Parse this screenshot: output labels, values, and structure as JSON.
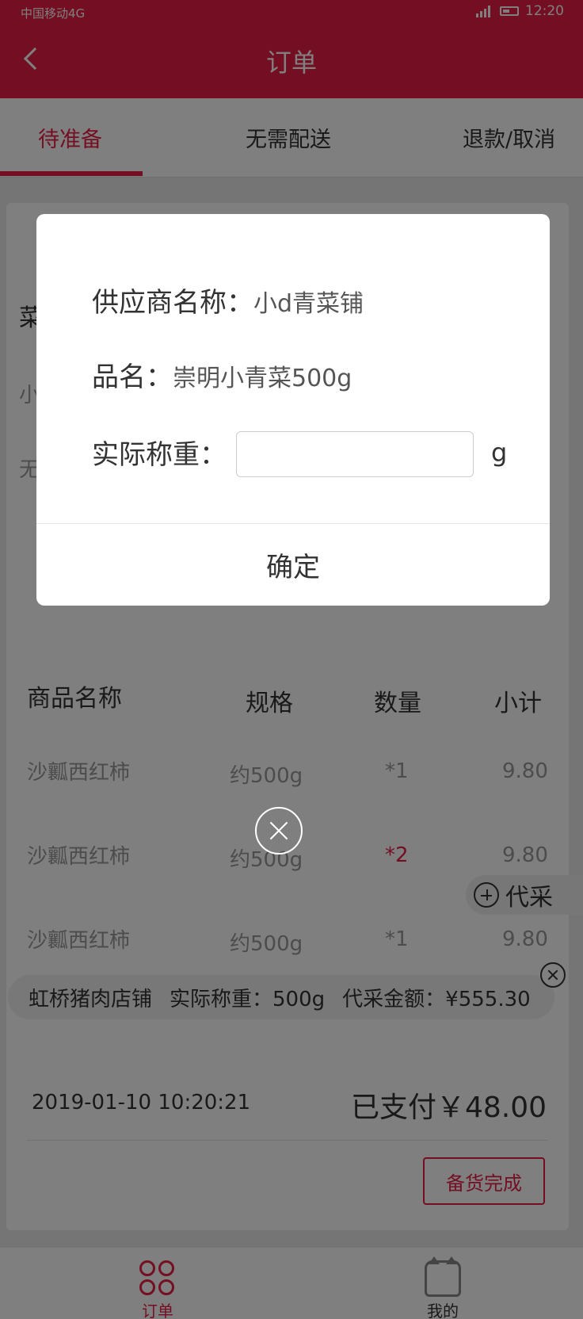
{
  "status_bar": {
    "carrier": "中国移动4G",
    "time": "12:20"
  },
  "header": {
    "title": "订单"
  },
  "tabs": [
    {
      "label": "待准备"
    },
    {
      "label": "无需配送"
    },
    {
      "label": "退款/取消"
    }
  ],
  "card": {
    "fragments": [
      "菜",
      "小",
      "无"
    ],
    "columns": [
      "商品名称",
      "规格",
      "数量",
      "小计"
    ],
    "rows": [
      {
        "name": "沙瓤西红柿",
        "spec": "约500g",
        "qty": "*1",
        "subtotal": "9.80"
      },
      {
        "name": "沙瓤西红柿",
        "spec": "约500g",
        "qty": "*2",
        "subtotal": "9.80"
      },
      {
        "name": "沙瓤西红柿",
        "spec": "约500g",
        "qty": "*1",
        "subtotal": "9.80"
      }
    ],
    "daicai_label": "代采",
    "purchase": {
      "shop": "虹桥猪肉店铺",
      "weight": "实际称重：500g",
      "amount": "代采金额：¥555.30"
    },
    "order_time": "2019-01-10   10:20:21",
    "paid": "已支付￥48.00",
    "stock_done_label": "备货完成"
  },
  "bottom_nav": {
    "orders": "订单",
    "mine": "我的"
  },
  "dialog": {
    "supplier_label": "供应商名称：",
    "supplier_value": "小d青菜铺",
    "product_label": "品名：",
    "product_value": "崇明小青菜500g",
    "weight_label": "实际称重：",
    "weight_value": "",
    "unit": "g",
    "confirm_label": "确定"
  }
}
